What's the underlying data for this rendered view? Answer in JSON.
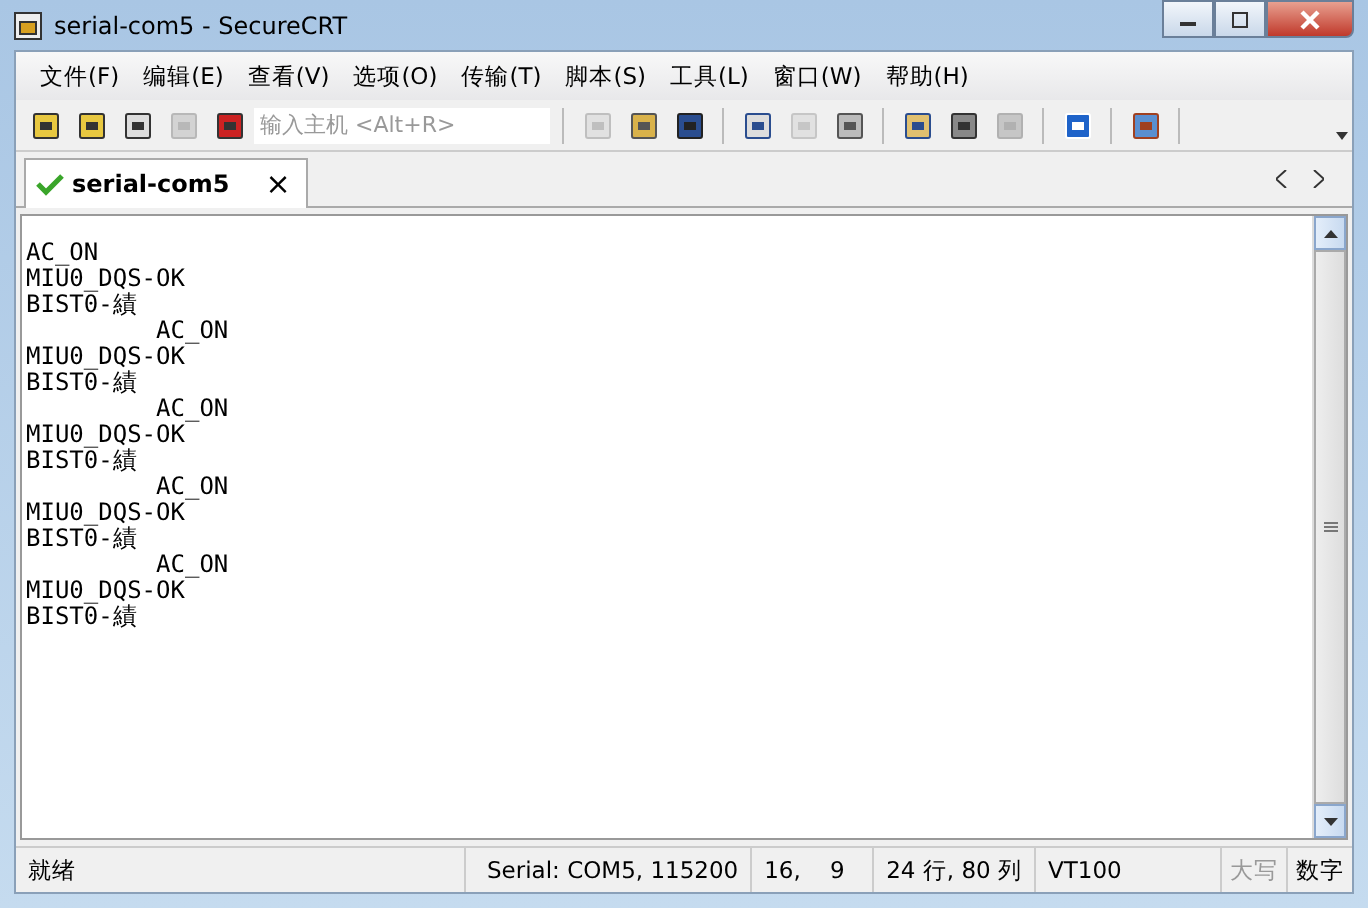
{
  "window": {
    "title": "serial-com5 - SecureCRT"
  },
  "menu": [
    "文件(F)",
    "编辑(E)",
    "查看(V)",
    "选项(O)",
    "传输(T)",
    "脚本(S)",
    "工具(L)",
    "窗口(W)",
    "帮助(H)"
  ],
  "toolbar": {
    "groups": [
      [
        {
          "disabled": false
        },
        {
          "disabled": false
        },
        {
          "disabled": false
        },
        {
          "disabled": true
        },
        {
          "disabled": false
        }
      ],
      [
        {
          "disabled": true
        },
        {
          "disabled": false
        },
        {
          "disabled": false
        }
      ],
      [
        {
          "disabled": false
        },
        {
          "disabled": true
        },
        {
          "disabled": false
        }
      ],
      [
        {
          "disabled": false
        },
        {
          "disabled": false
        },
        {
          "disabled": true
        }
      ],
      [
        {
          "disabled": false
        }
      ],
      [
        {
          "disabled": false
        }
      ]
    ],
    "host_field": {
      "placeholder": "输入主机 <Alt+R>"
    }
  },
  "tabs": [
    {
      "label": "serial-com5",
      "selected": true,
      "connected": true,
      "close_glyph": "×"
    }
  ],
  "terminal": {
    "lines": [
      "AC_ON",
      "MIU0_DQS-OK",
      "BIST0-績",
      "         AC_ON",
      "MIU0_DQS-OK",
      "BIST0-績",
      "         AC_ON",
      "MIU0_DQS-OK",
      "BIST0-績",
      "         AC_ON",
      "MIU0_DQS-OK",
      "BIST0-績",
      "         AC_ON",
      "MIU0_DQS-OK",
      "BIST0-績"
    ]
  },
  "status_bar": {
    "message": "就绪",
    "connection": "Serial: COM5, 115200",
    "cursor": "16,    9",
    "size": "24 行, 80 列",
    "emulation": "VT100",
    "indicators": [
      {
        "label": "大写",
        "on": false
      },
      {
        "label": "数字",
        "on": true
      }
    ]
  }
}
